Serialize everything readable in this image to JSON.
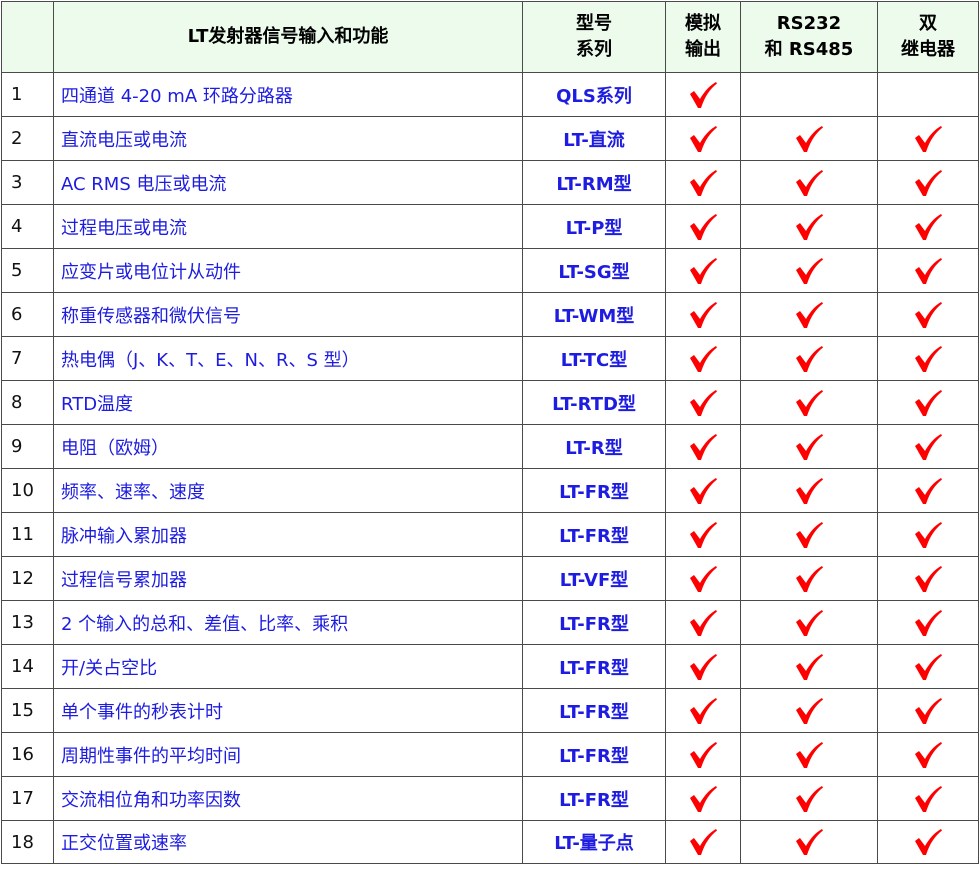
{
  "header": {
    "col_function": "LT发射器信号输入和功能",
    "col_model_line1": "型号",
    "col_model_line2": "系列",
    "col_analog_line1": "模拟",
    "col_analog_line2": "输出",
    "col_serial_line1": "RS232",
    "col_serial_line2": "和 RS485",
    "col_relay_line1": "双",
    "col_relay_line2": "继电器"
  },
  "check_color": "#ff0000",
  "check_icon": "red-checkmark",
  "rows": [
    {
      "num": "1",
      "function": "四通道 4-20 mA 环路分路器",
      "model": "QLS系列",
      "analog": true,
      "serial": false,
      "relay": false
    },
    {
      "num": "2",
      "function": "直流电压或电流",
      "model": "LT-直流",
      "analog": true,
      "serial": true,
      "relay": true
    },
    {
      "num": "3",
      "function": "AC RMS 电压或电流",
      "model": "LT-RM型",
      "analog": true,
      "serial": true,
      "relay": true
    },
    {
      "num": "4",
      "function": "过程电压或电流",
      "model": "LT-P型",
      "analog": true,
      "serial": true,
      "relay": true
    },
    {
      "num": "5",
      "function": "应变片或电位计从动件",
      "model": "LT-SG型",
      "analog": true,
      "serial": true,
      "relay": true
    },
    {
      "num": "6",
      "function": "称重传感器和微伏信号",
      "model": "LT-WM型",
      "analog": true,
      "serial": true,
      "relay": true
    },
    {
      "num": "7",
      "function": "热电偶（J、K、T、E、N、R、S 型）",
      "model": "LT-TC型",
      "analog": true,
      "serial": true,
      "relay": true
    },
    {
      "num": "8",
      "function": "RTD温度",
      "model": "LT-RTD型",
      "analog": true,
      "serial": true,
      "relay": true
    },
    {
      "num": "9",
      "function": "电阻（欧姆）",
      "model": "LT-R型",
      "analog": true,
      "serial": true,
      "relay": true
    },
    {
      "num": "10",
      "function": "频率、速率、速度",
      "model": "LT-FR型",
      "analog": true,
      "serial": true,
      "relay": true
    },
    {
      "num": "11",
      "function": "脉冲输入累加器",
      "model": "LT-FR型",
      "analog": true,
      "serial": true,
      "relay": true
    },
    {
      "num": "12",
      "function": "过程信号累加器",
      "model": "LT-VF型",
      "analog": true,
      "serial": true,
      "relay": true
    },
    {
      "num": "13",
      "function": "2 个输入的总和、差值、比率、乘积",
      "model": "LT-FR型",
      "analog": true,
      "serial": true,
      "relay": true
    },
    {
      "num": "14",
      "function": "开/关占空比",
      "model": "LT-FR型",
      "analog": true,
      "serial": true,
      "relay": true
    },
    {
      "num": "15",
      "function": "单个事件的秒表计时",
      "model": "LT-FR型",
      "analog": true,
      "serial": true,
      "relay": true
    },
    {
      "num": "16",
      "function": "周期性事件的平均时间",
      "model": "LT-FR型",
      "analog": true,
      "serial": true,
      "relay": true
    },
    {
      "num": "17",
      "function": "交流相位角和功率因数",
      "model": "LT-FR型",
      "analog": true,
      "serial": true,
      "relay": true
    },
    {
      "num": "18",
      "function": "正交位置或速率",
      "model": "LT-量子点",
      "analog": true,
      "serial": true,
      "relay": true
    }
  ]
}
